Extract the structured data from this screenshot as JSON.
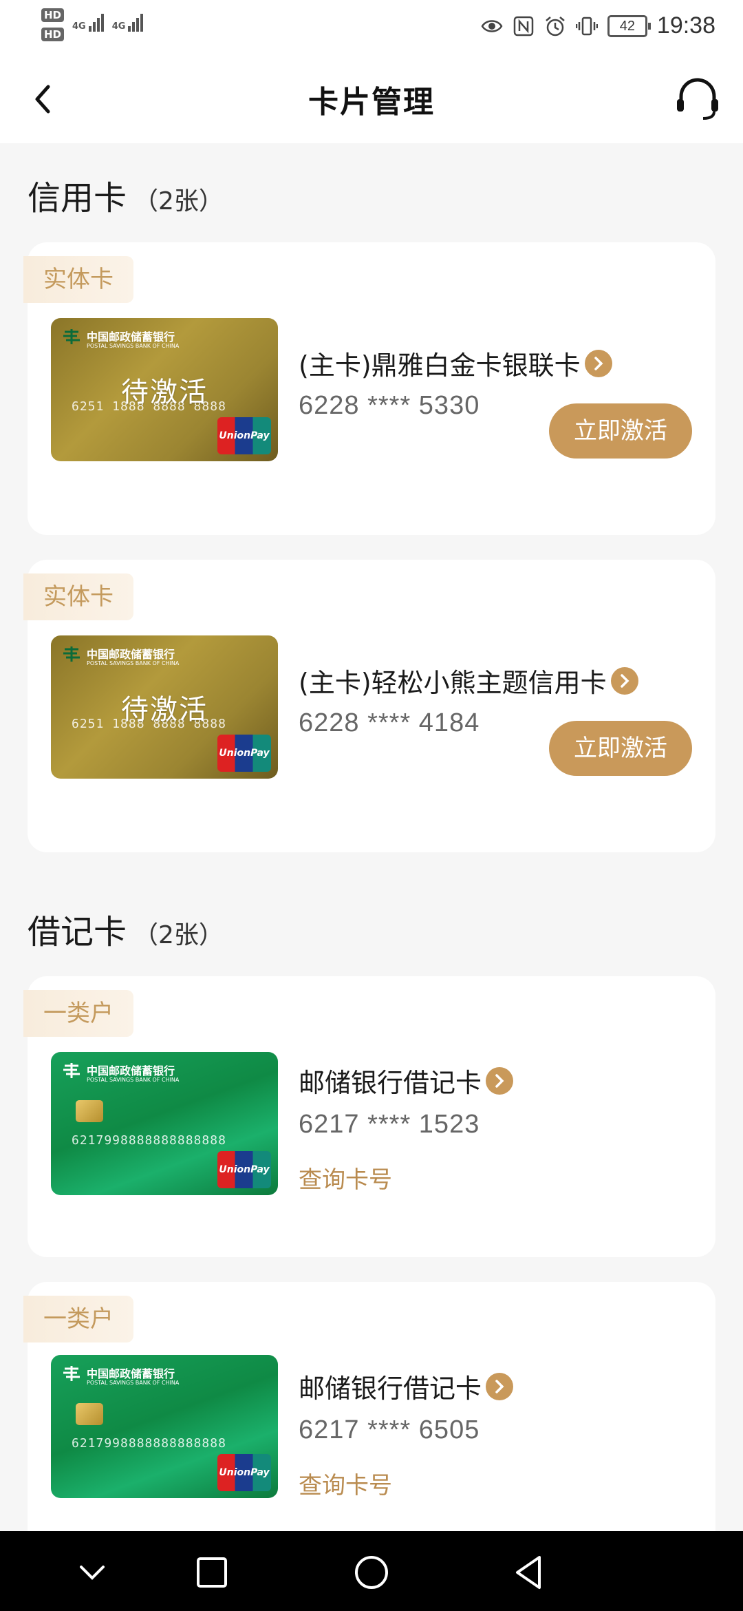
{
  "status_bar": {
    "hd1": "HD",
    "hd2": "HD",
    "net1": "4G",
    "net2": "4G",
    "battery": "42",
    "time": "19:38",
    "icons": [
      "eye-icon",
      "nfc-icon",
      "alarm-icon",
      "vibrate-icon",
      "battery-icon"
    ]
  },
  "header": {
    "title": "卡片管理",
    "back_icon": "chevron-left-icon",
    "service_icon": "headset-icon"
  },
  "sections": {
    "credit": {
      "title": "信用卡",
      "count": "（2张）",
      "cards": [
        {
          "tag": "实体卡",
          "name": "(主卡)鼎雅白金卡银联卡",
          "number": "6228 **** 5330",
          "overlay": "待激活",
          "action": "立即激活"
        },
        {
          "tag": "实体卡",
          "name": "(主卡)轻松小熊主题信用卡",
          "number": "6228 **** 4184",
          "overlay": "待激活",
          "action": "立即激活"
        }
      ]
    },
    "debit": {
      "title": "借记卡",
      "count": "（2张）",
      "cards": [
        {
          "tag": "一类户",
          "name": "邮储银行借记卡",
          "number": "6217 **** 1523",
          "action": "查询卡号"
        },
        {
          "tag": "一类户",
          "name": "邮储银行借记卡",
          "number": "6217 **** 6505",
          "action": "查询卡号"
        }
      ]
    }
  },
  "card_art": {
    "bank_cn": "中国邮政储蓄银行",
    "bank_en": "POSTAL SAVINGS BANK OF CHINA",
    "gold_num": "6251 1888 8888 8888",
    "green_num": "6217998888888888888",
    "unionpay": "UnionPay 银联"
  },
  "system_nav": {
    "icons": [
      "chevron-down-icon",
      "square-icon",
      "circle-icon",
      "triangle-back-icon"
    ]
  },
  "colors": {
    "accent": "#c9995a",
    "tag_bg": "#f8ecdc",
    "tag_text": "#c49a5d",
    "link": "#b98b4f",
    "page_bg": "#f6f6f6"
  }
}
